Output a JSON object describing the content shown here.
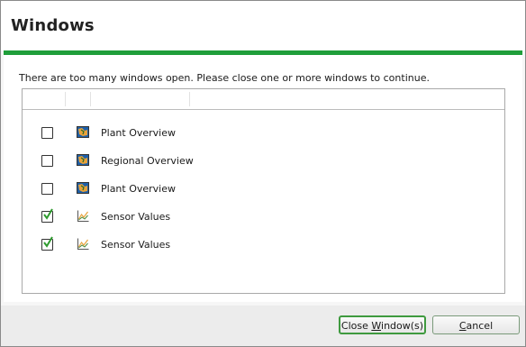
{
  "dialog": {
    "title": "Windows",
    "message": "There are too many windows open.  Please close one or more windows to continue.",
    "accent_color": "#1f9e3a"
  },
  "windows_list": {
    "items": [
      {
        "checked": false,
        "icon": "map-icon",
        "label": "Plant Overview"
      },
      {
        "checked": false,
        "icon": "map-icon",
        "label": "Regional Overview"
      },
      {
        "checked": false,
        "icon": "map-icon",
        "label": "Plant Overview"
      },
      {
        "checked": true,
        "icon": "chart-icon",
        "label": "Sensor Values"
      },
      {
        "checked": true,
        "icon": "chart-icon",
        "label": "Sensor Values"
      }
    ]
  },
  "buttons": {
    "close_pre": "Close ",
    "close_mnemonic": "W",
    "close_post": "indow(s)",
    "cancel_mnemonic": "C",
    "cancel_post": "ancel"
  }
}
